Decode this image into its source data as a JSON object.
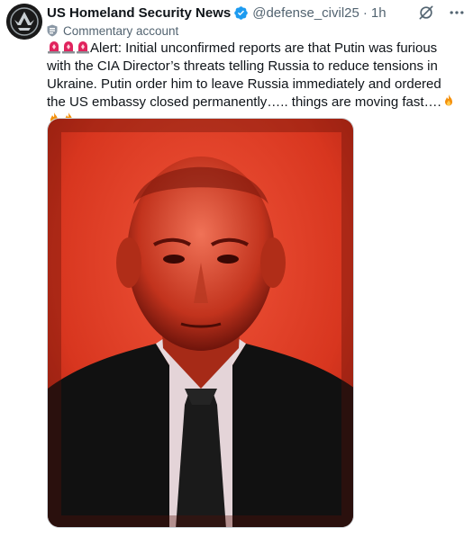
{
  "author": {
    "display_name": "US Homeland Security News",
    "handle": "@defense_civil25",
    "separator": "·",
    "timestamp": "1h",
    "label": "Commentary account",
    "verified": true,
    "verified_color": "#1d9bf0"
  },
  "post": {
    "text": "Alert: Initial unconfirmed reports are that Putin was furious with the CIA Director’s threats telling Russia to reduce tensions in Ukraine. Putin order him to leave Russia immediately and ordered the US embassy closed permanently….. things are moving fast….",
    "leading_emoji": [
      "police-light-emoji",
      "police-light-emoji",
      "police-light-emoji"
    ],
    "trailing_emoji": [
      "fire-emoji",
      "fire-emoji",
      "fire-emoji"
    ]
  },
  "media": {
    "kind": "photo",
    "tint": "#e0452d"
  },
  "colors": {
    "text_primary": "#0f1419",
    "text_secondary": "#536471",
    "border": "#cfd9de"
  }
}
